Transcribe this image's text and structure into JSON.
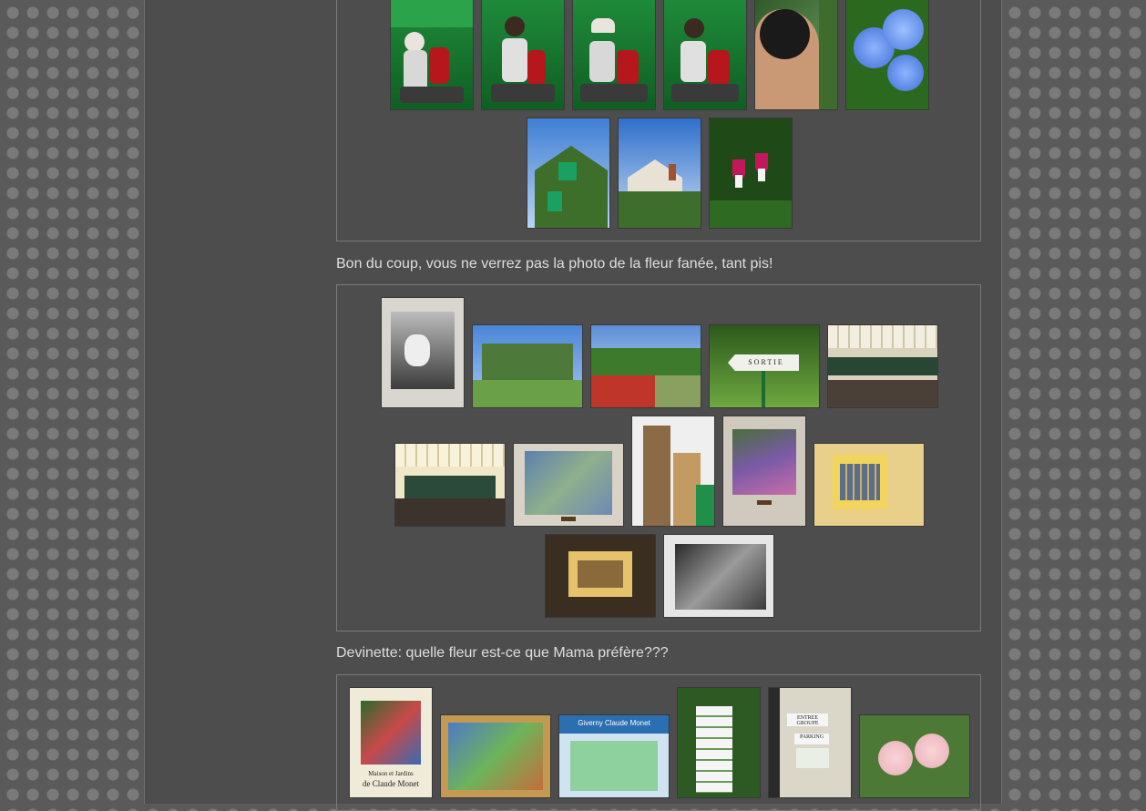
{
  "captions": {
    "caption_1": "Bon du coup, vous ne verrez pas la photo de la fleur fanée, tant pis!",
    "caption_2": "Devinette: quelle fleur est-ce que Mama préfère???"
  },
  "sign_texts": {
    "sortie": "SORTIE",
    "poster_line1": "Maison et Jardins",
    "poster_line2": "de Claude Monet",
    "map_title": "Giverny Claude Monet",
    "sign_entree": "ENTREE GROUPE",
    "sign_parking": "PARKING"
  },
  "colors": {
    "page_bg": "#4d4d4d",
    "pattern_bg": "#5a5a5a",
    "caption_text": "#dedede",
    "gallery_border": "#7a7a7a"
  }
}
